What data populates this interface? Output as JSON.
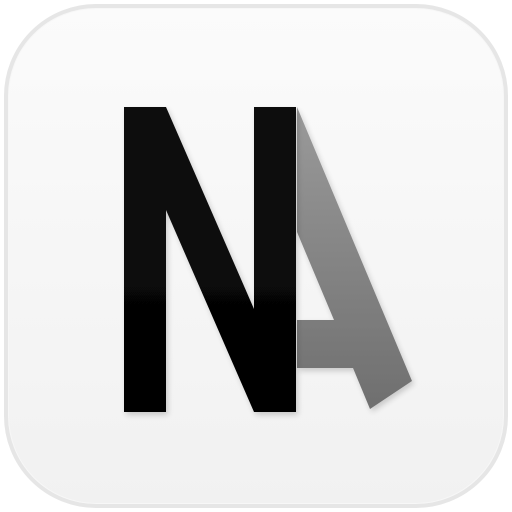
{
  "app_icon": {
    "logo": {
      "icon": "na-monogram-icon",
      "letters": [
        "N",
        "A"
      ],
      "colors": {
        "n_top": "#111111",
        "n_bottom": "#000000",
        "a_top": "#9a9a9a",
        "a_bottom": "#6f6f6f",
        "background_top": "#fbfbfb",
        "background_bottom": "#f1f1f1",
        "border": "#e6e6e6"
      }
    }
  }
}
